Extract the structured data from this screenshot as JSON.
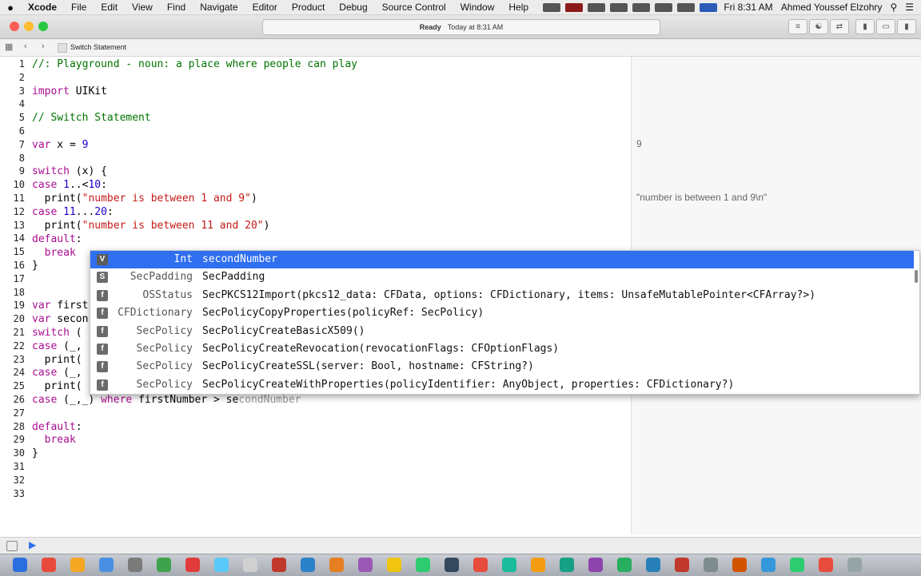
{
  "menubar": {
    "apple": "",
    "items": [
      "Xcode",
      "File",
      "Edit",
      "View",
      "Find",
      "Navigate",
      "Editor",
      "Product",
      "Debug",
      "Source Control",
      "Window",
      "Help"
    ],
    "clock": "Fri 8:31 AM",
    "user": "Ahmed Youssef Elzohry"
  },
  "toolbar": {
    "status": "Ready",
    "status_detail": "Today at 8:31 AM",
    "traffic_colors": [
      "#fc5f57",
      "#fdbc2e",
      "#29c840"
    ]
  },
  "jumpbar": {
    "file": "Switch Statement"
  },
  "editor": {
    "line_numbers": [
      "1",
      "2",
      "3",
      "4",
      "5",
      "6",
      "7",
      "8",
      "9",
      "10",
      "11",
      "12",
      "13",
      "14",
      "15",
      "16",
      "17",
      "18",
      "19",
      "20",
      "21",
      "22",
      "23",
      "24",
      "25",
      "26",
      "27",
      "28",
      "29",
      "30",
      "31",
      "32",
      "33"
    ],
    "line1": "//: Playground - noun: a place where people can play",
    "line3_kw": "import",
    "line3_rest": " UIKit",
    "line5": "// Switch Statement",
    "line7_kw": "var",
    "line7_mid": " x = ",
    "line7_num": "9",
    "line9_kw": "switch",
    "line9_rest": " (x) {",
    "line10_kw": "case",
    "line10_a": "1",
    "line10_op": "..<",
    "line10_b": "10",
    "line10_end": ":",
    "line11_a": "  print(",
    "line11_str": "\"number is between 1 and 9\"",
    "line11_end": ")",
    "line12_kw": "case",
    "line12_a": "11",
    "line12_op": "...",
    "line12_b": "20",
    "line12_end": ":",
    "line13_a": "  print(",
    "line13_str": "\"number is between 11 and 20\"",
    "line13_end": ")",
    "line14_kw": "default",
    "line14_end": ":",
    "line15_kw": "  break",
    "line16": "}",
    "line19_kw": "var",
    "line19_rest": " first",
    "line20_kw": "var",
    "line20_rest": " secon",
    "line21_kw": "switch",
    "line21_rest": " (",
    "line22_kw": "case",
    "line22_rest": " (_,",
    "line23": "  print(",
    "line24_kw": "case",
    "line24_rest": " (_,",
    "line25": "  print(",
    "line26_kw": "case",
    "line26_a": " (_,_) ",
    "line26_where": "where",
    "line26_b": " firstNumber > se",
    "line26_ghost": "condNumber",
    "line28_kw": "default",
    "line28_end": ":",
    "line29_kw": "  break",
    "line30": "}"
  },
  "results": {
    "line7": "9",
    "line11": "\"number is between 1 and 9\\n\""
  },
  "completion": {
    "items": [
      {
        "kind": "V",
        "kind_color": "#9b59b6",
        "type": "Int",
        "name": "secondNumber",
        "args": ""
      },
      {
        "kind": "S",
        "kind_color": "#8b6ab0",
        "type": "SecPadding",
        "name": "SecPadding",
        "args": ""
      },
      {
        "kind": "f",
        "kind_color": "#5b8dd6",
        "type": "OSStatus",
        "name": "SecPKCS12Import",
        "args": "(pkcs12_data: CFData, options: CFDictionary, items: UnsafeMutablePointer<CFArray?>)"
      },
      {
        "kind": "f",
        "kind_color": "#5b8dd6",
        "type": "CFDictionary",
        "name": "SecPolicyCopyProperties",
        "args": "(policyRef: SecPolicy)"
      },
      {
        "kind": "f",
        "kind_color": "#5b8dd6",
        "type": "SecPolicy",
        "name": "SecPolicyCreateBasicX509",
        "args": "()"
      },
      {
        "kind": "f",
        "kind_color": "#5b8dd6",
        "type": "SecPolicy",
        "name": "SecPolicyCreateRevocation",
        "args": "(revocationFlags: CFOptionFlags)"
      },
      {
        "kind": "f",
        "kind_color": "#5b8dd6",
        "type": "SecPolicy",
        "name": "SecPolicyCreateSSL",
        "args": "(server: Bool, hostname: CFString?)"
      },
      {
        "kind": "f",
        "kind_color": "#5b8dd6",
        "type": "SecPolicy",
        "name": "SecPolicyCreateWithProperties",
        "args": "(policyIdentifier: AnyObject, properties: CFDictionary?)"
      }
    ]
  },
  "dock": {
    "icon_colors": [
      "#2a6fe0",
      "#e84b3c",
      "#f5a623",
      "#4a90e2",
      "#7b7b7b",
      "#3fa34d",
      "#e23b3b",
      "#5ac8fa",
      "#d0d0d0",
      "#c0392b",
      "#2c82c9",
      "#e67e22",
      "#9b59b6",
      "#f1c40f",
      "#2ecc71",
      "#34495e",
      "#e74c3c",
      "#1abc9c",
      "#f39c12",
      "#16a085",
      "#8e44ad",
      "#27ae60",
      "#2980b9",
      "#c0392b",
      "#7f8c8d",
      "#d35400",
      "#3498db",
      "#2ecc71",
      "#e74c3c",
      "#95a5a6"
    ]
  }
}
